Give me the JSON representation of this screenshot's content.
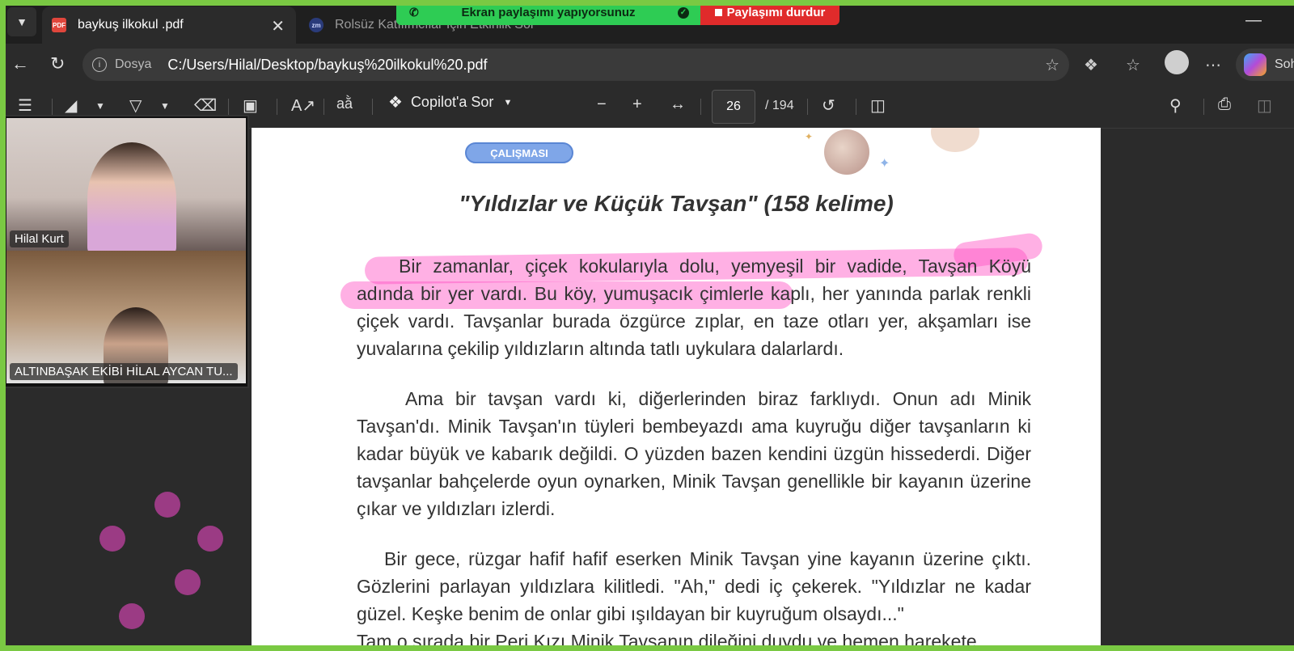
{
  "tabs": [
    {
      "title": "baykuş ilkokul .pdf",
      "favicon": "PDF",
      "active": true
    },
    {
      "title": "Rolsüz Katılımcılar İçin Etkinlik Sor",
      "favicon": "zm",
      "active": false
    }
  ],
  "screen_share": {
    "status": "Ekran paylaşımı yapıyorsunuz",
    "stop_label": "Paylaşımı durdur"
  },
  "address_bar": {
    "protocol": "Dosya",
    "url": "C:/Users/Hilal/Desktop/baykuş%20ilkokul%20.pdf"
  },
  "copilot_pill": "Soh",
  "pdf_toolbar": {
    "copilot_label": "Copilot'a Sor",
    "current_page": "26",
    "total_pages": "/ 194"
  },
  "document": {
    "badge": "ÇALIŞMASI",
    "title": "\"Yıldızlar ve Küçük Tavşan\" (158 kelime)",
    "paragraphs": [
      "Bir zamanlar, çiçek kokularıyla dolu, yemyeşil bir vadide, Tavşan Köyü adında bir yer vardı. Bu köy, yumuşacık çimlerle kaplı, her yanında parlak renkli çiçek vardı. Tavşanlar burada özgürce zıplar, en taze otları yer, akşamları ise yuvalarına çekilip yıldızların altında tatlı uykulara dalarlardı.",
      "Ama bir tavşan vardı ki, diğerlerinden biraz farklıydı. Onun adı Minik Tavşan'dı. Minik Tavşan'ın tüyleri bembeyazdı ama kuyruğu diğer tavşanların ki kadar büyük ve kabarık değildi. O yüzden bazen kendini üzgün hissederdi. Diğer tavşanlar bahçelerde oyun oynarken, Minik Tavşan genellikle bir kayanın üzerine çıkar ve yıldızları izlerdi.",
      "Bir gece, rüzgar hafif hafif eserken Minik Tavşan yine kayanın üzerine çıktı. Gözlerini parlayan yıldızlara kilitledi. \"Ah,\" dedi iç çekerek. \"Yıldızlar ne kadar güzel. Keşke benim de onlar gibi ışıldayan bir kuyruğum olsaydı...\"",
      "Tam o sırada bir Peri Kızı Minik Tavşanın dileğini duydu ve hemen harekete"
    ]
  },
  "video": {
    "participants": [
      {
        "name": "Hilal Kurt"
      },
      {
        "name": "ALTINBAŞAK EKİBİ HİLAL AYCAN TU..."
      }
    ]
  },
  "colors": {
    "share_green": "#2ecc54",
    "share_red": "#e02b2b",
    "highlight": "#ff4fc3",
    "frame": "#7ac943"
  }
}
